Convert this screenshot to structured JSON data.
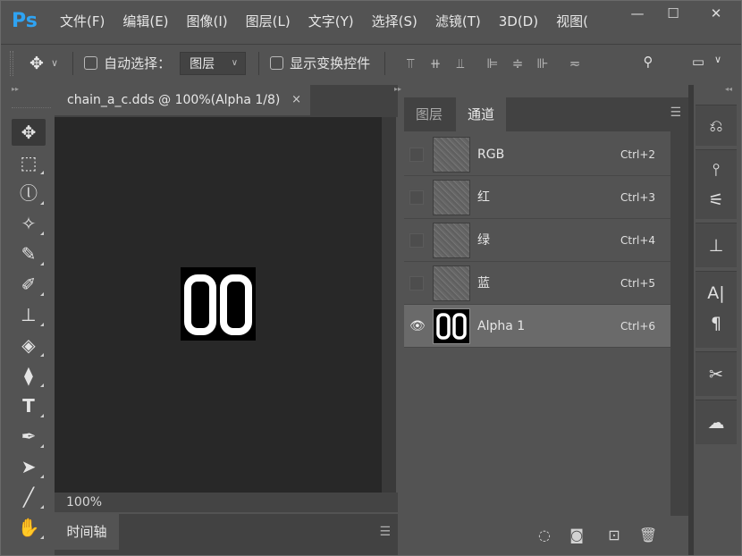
{
  "app": {
    "logo": "Ps"
  },
  "menu": [
    "文件(F)",
    "编辑(E)",
    "图像(I)",
    "图层(L)",
    "文字(Y)",
    "选择(S)",
    "滤镜(T)",
    "3D(D)",
    "视图("
  ],
  "window_controls": {
    "minimize": "—",
    "restore": "☐",
    "close": "✕"
  },
  "options_bar": {
    "auto_select_label": "自动选择：",
    "auto_select_value": "图层",
    "show_transform_label": "显示变换控件"
  },
  "document": {
    "tab_title": "chain_a_c.dds @ 100%(Alpha 1/8)",
    "tab_close": "×",
    "image_text": "00",
    "zoom": "100%"
  },
  "timeline": {
    "tab_label": "时间轴"
  },
  "panel": {
    "tabs": [
      "图层",
      "通道"
    ],
    "active_tab": "通道",
    "channels": [
      {
        "name": "RGB",
        "shortcut": "Ctrl+2",
        "visible": false,
        "selected": false
      },
      {
        "name": "红",
        "shortcut": "Ctrl+3",
        "visible": false,
        "selected": false
      },
      {
        "name": "绿",
        "shortcut": "Ctrl+4",
        "visible": false,
        "selected": false
      },
      {
        "name": "蓝",
        "shortcut": "Ctrl+5",
        "visible": false,
        "selected": false
      },
      {
        "name": "Alpha 1",
        "shortcut": "Ctrl+6",
        "visible": true,
        "selected": true,
        "thumb_text": "00"
      }
    ]
  },
  "icons": {
    "tools": [
      "move-icon",
      "marquee-icon",
      "lasso-icon",
      "magic-wand-icon",
      "eyedropper-icon",
      "brush-icon",
      "stamp-icon",
      "eraser-icon",
      "paint-bucket-icon",
      "type-icon",
      "pen-icon",
      "path-select-icon",
      "line-icon",
      "hand-icon"
    ],
    "dock": [
      "history-icon",
      "brushes-icon",
      "adjustments-icon",
      "clone-source-icon",
      "character-icon",
      "paragraph-icon",
      "tool-presets-icon",
      "libraries-icon"
    ]
  },
  "colors": {
    "accent": "#2fa3f2",
    "bg": "#535353",
    "canvas": "#282828"
  }
}
